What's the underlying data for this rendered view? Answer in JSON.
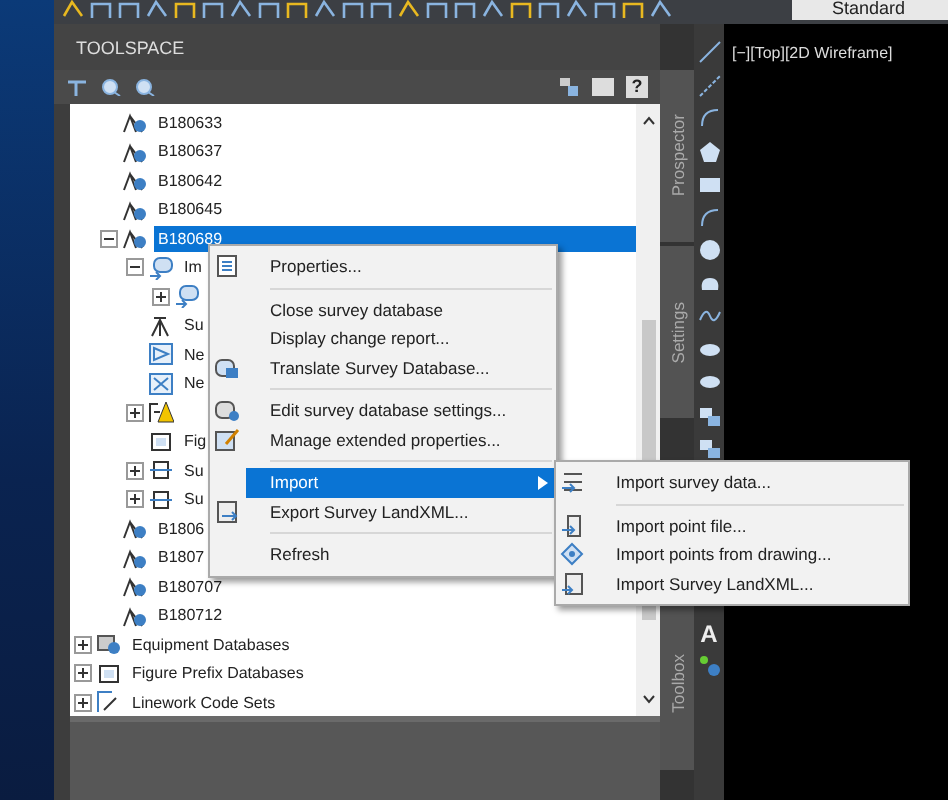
{
  "toolbar": {
    "style_dropdown": "Standard"
  },
  "toolspace": {
    "title": "TOOLSPACE",
    "help_button": "?",
    "tree": {
      "survey_databases": [
        {
          "label": "B180633",
          "kind": "database",
          "selected": false
        },
        {
          "label": "B180637",
          "kind": "database",
          "selected": false
        },
        {
          "label": "B180642",
          "kind": "database",
          "selected": false
        },
        {
          "label": "B180645",
          "kind": "database",
          "selected": false
        },
        {
          "label": "B180689",
          "kind": "database",
          "selected": true,
          "expanded": true,
          "children": [
            {
              "label": "Im",
              "kind": "import",
              "expanded": true,
              "children": [
                {
                  "kind": "import",
                  "expanded": false
                }
              ]
            },
            {
              "label": "Su",
              "kind": "survey"
            },
            {
              "label": "Ne",
              "kind": "network"
            },
            {
              "label": "Ne",
              "kind": "network2"
            },
            {
              "kind": "warning",
              "expanded": false
            },
            {
              "label": "Fig",
              "kind": "figure"
            },
            {
              "label": "Su",
              "kind": "group",
              "expanded": false
            },
            {
              "label": "Su",
              "kind": "group2",
              "expanded": false
            }
          ]
        },
        {
          "label": "B1806",
          "kind": "database",
          "selected": false
        },
        {
          "label": "B1807",
          "kind": "database",
          "selected": false
        },
        {
          "label": "B180707",
          "kind": "database",
          "selected": false
        },
        {
          "label": "B180712",
          "kind": "database",
          "selected": false
        }
      ],
      "root_items": [
        {
          "label": "Equipment Databases",
          "kind": "equipment",
          "selected": false,
          "expanded": false
        },
        {
          "label": "Figure Prefix Databases",
          "kind": "figure",
          "selected": false,
          "expanded": false
        },
        {
          "label": "Linework Code Sets",
          "kind": "linework",
          "selected": false,
          "expanded": false
        }
      ]
    }
  },
  "context_menu": {
    "items": [
      {
        "label": "Properties...",
        "selected": false
      },
      {
        "label": "Close survey database",
        "separator_before": true,
        "selected": false
      },
      {
        "label": "Display change report...",
        "selected": false
      },
      {
        "label": "Translate Survey Database...",
        "selected": false
      },
      {
        "label": "Edit survey database settings...",
        "separator_before": true,
        "selected": false
      },
      {
        "label": "Manage extended properties...",
        "selected": false
      },
      {
        "label": "Import",
        "separator_before": true,
        "selected": true,
        "submenu": true
      },
      {
        "label": "Export Survey LandXML...",
        "selected": false
      },
      {
        "label": "Refresh",
        "separator_before": true,
        "selected": false
      }
    ]
  },
  "submenu": {
    "items": [
      {
        "label": "Import survey data...",
        "selected": false
      },
      {
        "label": "Import point file...",
        "separator_before": true,
        "selected": false
      },
      {
        "label": "Import points from drawing...",
        "selected": false
      },
      {
        "label": "Import Survey LandXML...",
        "selected": false
      }
    ]
  },
  "side_tabs": [
    {
      "label": "Prospector"
    },
    {
      "label": "Settings"
    },
    {
      "label": "Toolbox"
    }
  ],
  "palette": {
    "text_tool": "A"
  },
  "viewport": {
    "label": "[−][Top][2D Wireframe]"
  }
}
